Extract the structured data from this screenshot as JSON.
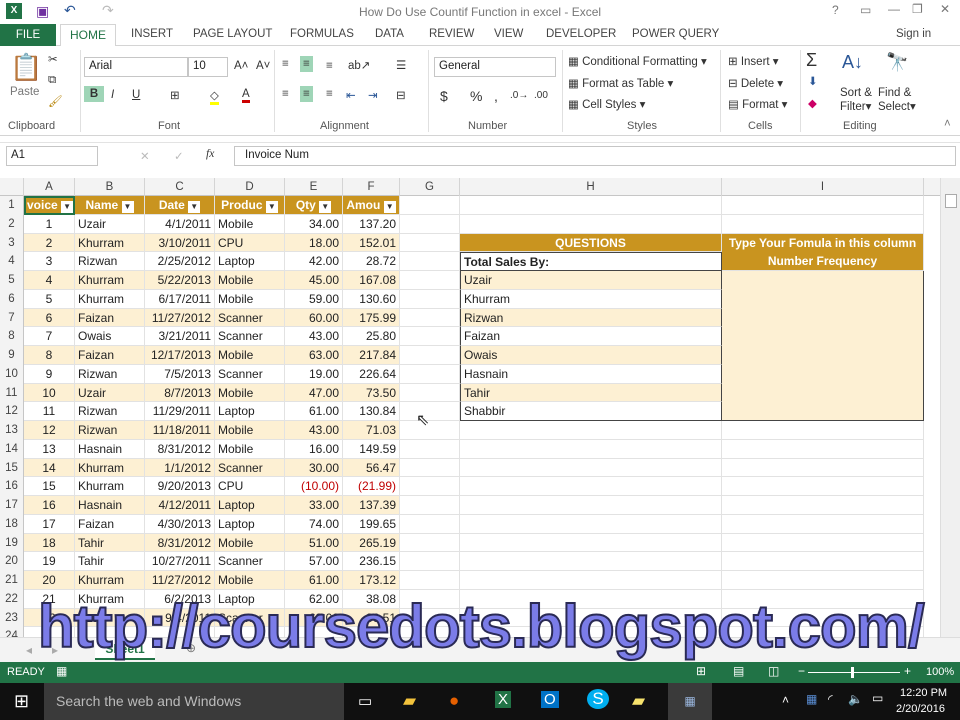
{
  "title": "How Do Use Countif Function in excel - Excel",
  "tabs": [
    "FILE",
    "HOME",
    "INSERT",
    "PAGE LAYOUT",
    "FORMULAS",
    "DATA",
    "REVIEW",
    "VIEW",
    "DEVELOPER",
    "POWER QUERY"
  ],
  "sign_in": "Sign in",
  "ribbon": {
    "paste": "Paste",
    "font": "Arial",
    "size": "10",
    "number_format": "General",
    "conditional": "Conditional Formatting",
    "format_table": "Format as Table",
    "cell_styles": "Cell Styles",
    "insert": "Insert",
    "delete": "Delete",
    "format": "Format",
    "sort": "Sort &",
    "filter": "Filter",
    "find": "Find &",
    "select": "Select",
    "groups": [
      "Clipboard",
      "Font",
      "Alignment",
      "Number",
      "Styles",
      "Cells",
      "Editing"
    ]
  },
  "name_box": "A1",
  "formula": "Invoice Num",
  "columns": [
    "A",
    "B",
    "C",
    "D",
    "E",
    "F",
    "G",
    "H",
    "I"
  ],
  "headers": [
    "voice",
    "Name",
    "Date",
    "Produc",
    "Qty",
    "Amou"
  ],
  "rows": [
    [
      "1",
      "Uzair",
      "4/1/2011",
      "Mobile",
      "34.00",
      "137.20"
    ],
    [
      "2",
      "Khurram",
      "3/10/2011",
      "CPU",
      "18.00",
      "152.01"
    ],
    [
      "3",
      "Rizwan",
      "2/25/2012",
      "Laptop",
      "42.00",
      "28.72"
    ],
    [
      "4",
      "Khurram",
      "5/22/2013",
      "Mobile",
      "45.00",
      "167.08"
    ],
    [
      "5",
      "Khurram",
      "6/17/2011",
      "Mobile",
      "59.00",
      "130.60"
    ],
    [
      "6",
      "Faizan",
      "11/27/2012",
      "Scanner",
      "60.00",
      "175.99"
    ],
    [
      "7",
      "Owais",
      "3/21/2011",
      "Scanner",
      "43.00",
      "25.80"
    ],
    [
      "8",
      "Faizan",
      "12/17/2013",
      "Mobile",
      "63.00",
      "217.84"
    ],
    [
      "9",
      "Rizwan",
      "7/5/2013",
      "Scanner",
      "19.00",
      "226.64"
    ],
    [
      "10",
      "Uzair",
      "8/7/2013",
      "Mobile",
      "47.00",
      "73.50"
    ],
    [
      "11",
      "Rizwan",
      "11/29/2011",
      "Laptop",
      "61.00",
      "130.84"
    ],
    [
      "12",
      "Rizwan",
      "11/18/2011",
      "Mobile",
      "43.00",
      "71.03"
    ],
    [
      "13",
      "Hasnain",
      "8/31/2012",
      "Mobile",
      "16.00",
      "149.59"
    ],
    [
      "14",
      "Khurram",
      "1/1/2012",
      "Scanner",
      "30.00",
      "56.47"
    ],
    [
      "15",
      "Khurram",
      "9/20/2013",
      "CPU",
      "(10.00)",
      "(21.99)"
    ],
    [
      "16",
      "Hasnain",
      "4/12/2011",
      "Laptop",
      "33.00",
      "137.39"
    ],
    [
      "17",
      "Faizan",
      "4/30/2013",
      "Laptop",
      "74.00",
      "199.65"
    ],
    [
      "18",
      "Tahir",
      "8/31/2012",
      "Mobile",
      "51.00",
      "265.19"
    ],
    [
      "19",
      "Tahir",
      "10/27/2011",
      "Scanner",
      "57.00",
      "236.15"
    ],
    [
      "20",
      "Khurram",
      "11/27/2012",
      "Mobile",
      "61.00",
      "173.12"
    ],
    [
      "21",
      "Khurram",
      "6/2/2013",
      "Laptop",
      "62.00",
      "38.08"
    ],
    [
      "22",
      "Uzair",
      "9/4/2011",
      "Scanner",
      "63.00",
      "86.51"
    ]
  ],
  "questions": {
    "title": "QUESTIONS",
    "instruction": "Type Your Fomula in this column",
    "freq": "Number Frequency",
    "label": "Total Sales By:",
    "names": [
      "Uzair",
      "Khurram",
      "Rizwan",
      "Faizan",
      "Owais",
      "Hasnain",
      "Tahir",
      "Shabbir"
    ]
  },
  "sheet_tab": "Sheet1",
  "status": {
    "ready": "READY",
    "zoom": "100%"
  },
  "taskbar": {
    "search": "Search the web and Windows",
    "time": "12:20 PM",
    "date": "2/20/2016"
  },
  "watermark": "http://coursedots.blogspot.com/"
}
